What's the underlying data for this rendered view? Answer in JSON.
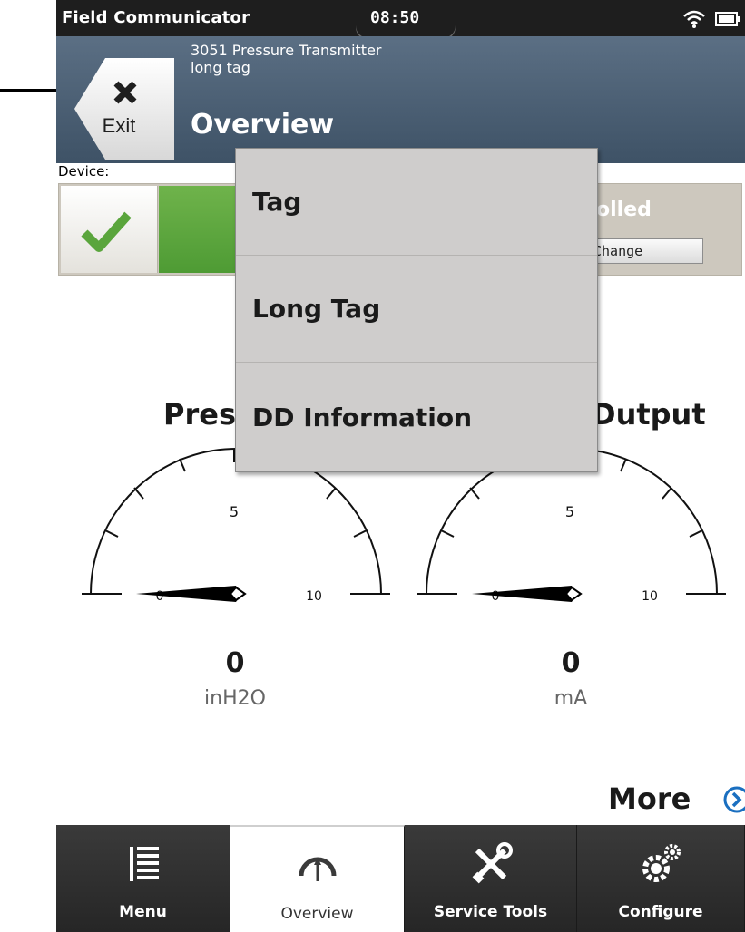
{
  "status_bar": {
    "app_name": "Field Communicator",
    "time": "08:50"
  },
  "header": {
    "exit_label": "Exit",
    "device_name": "3051 Pressure Transmitter",
    "device_tag": "long tag",
    "page_title": "Overview"
  },
  "device_status": {
    "label": "Device:",
    "polling_label": "olled",
    "change_label": "Change",
    "status_color": "#5aa53c"
  },
  "gauges": [
    {
      "title": "Pres",
      "tick_mid": "5",
      "tick_max": "10",
      "tick_min": "0",
      "value": "0",
      "unit": "inH2O"
    },
    {
      "title": "Dutput",
      "tick_mid": "5",
      "tick_max": "10",
      "tick_min": "0",
      "value": "0",
      "unit": "mA"
    }
  ],
  "more": {
    "label": "More",
    "icon": "chevron-circle-right-icon"
  },
  "tabs": [
    {
      "label": "Menu",
      "icon": "menu-list-icon"
    },
    {
      "label": "Overview",
      "icon": "gauge-icon",
      "selected": true
    },
    {
      "label": "Service Tools",
      "icon": "tools-icon"
    },
    {
      "label": "Configure",
      "icon": "gears-icon"
    }
  ],
  "popup_menu": {
    "items": [
      {
        "label": "Tag"
      },
      {
        "label": "Long Tag"
      },
      {
        "label": "DD Information"
      }
    ]
  },
  "colors": {
    "header": "#4d6176",
    "status_green": "#5aa53c",
    "accent_blue": "#1a6fc0"
  }
}
